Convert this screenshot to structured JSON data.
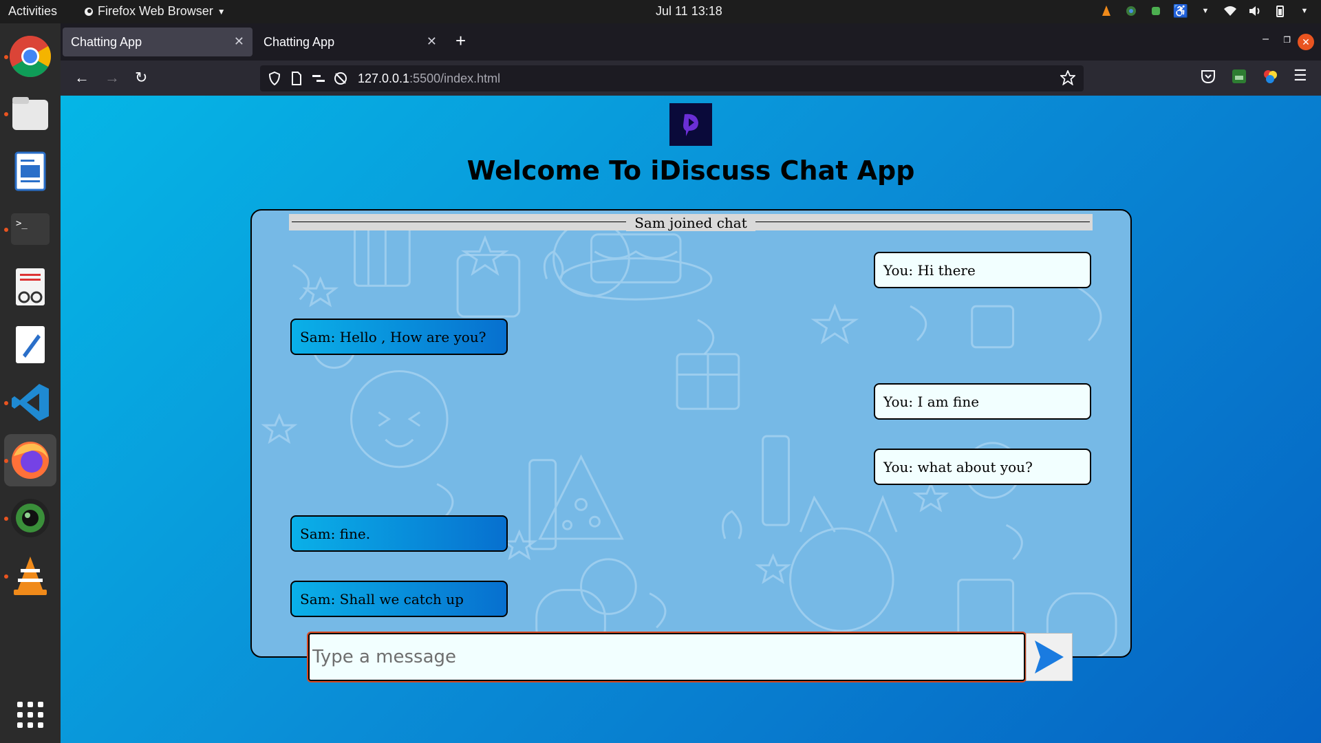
{
  "topbar": {
    "activities": "Activities",
    "app_menu": "Firefox Web Browser",
    "clock": "Jul 11  13:18"
  },
  "browser": {
    "tabs": [
      {
        "label": "Chatting App",
        "active": true
      },
      {
        "label": "Chatting App",
        "active": false
      }
    ],
    "url_host": "127.0.0.1",
    "url_path": ":5500/index.html"
  },
  "page": {
    "title": "Welcome To iDiscuss Chat App",
    "join_notice": "Sam joined chat",
    "messages": [
      {
        "side": "right",
        "text": "You: Hi there"
      },
      {
        "side": "left",
        "text": "Sam: Hello , How are you?"
      },
      {
        "side": "right",
        "text": "You: I am fine"
      },
      {
        "side": "right",
        "text": "You: what about you?"
      },
      {
        "side": "left",
        "text": "Sam: fine."
      },
      {
        "side": "left",
        "text": "Sam: Shall we catch up"
      }
    ],
    "input_placeholder": "Type a message"
  },
  "colors": {
    "page_gradient_start": "#05b6e6",
    "page_gradient_end": "#0563c3",
    "chat_background": "#76b9e6",
    "own_bubble": "#f2ffff",
    "other_bubble_start": "#0ab0e8",
    "other_bubble_end": "#0770cf",
    "ubuntu_orange": "#e95420"
  },
  "icons": {
    "dock": [
      "chrome-icon",
      "files-icon",
      "writer-icon",
      "terminal-icon",
      "document-viewer-icon",
      "text-editor-icon",
      "vscode-icon",
      "firefox-icon",
      "camera-icon",
      "vlc-icon",
      "app-grid-icon"
    ],
    "send": "send-arrow-icon"
  }
}
